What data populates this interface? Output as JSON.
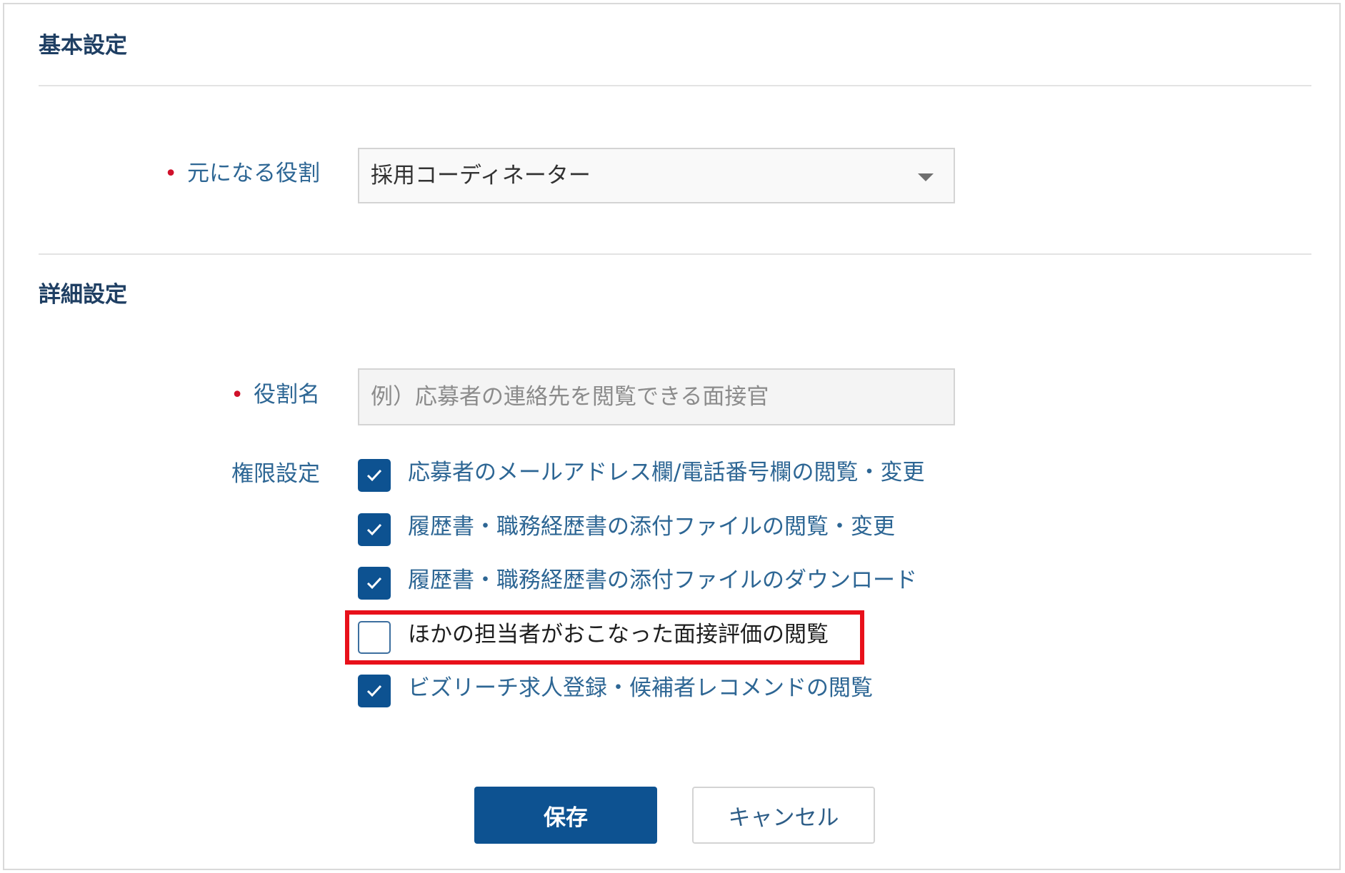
{
  "basic_settings": {
    "title": "基本設定",
    "base_role_label": "元になる役割",
    "base_role_value": "採用コーディネーター"
  },
  "detail_settings": {
    "title": "詳細設定",
    "role_name_label": "役割名",
    "role_name_placeholder": "例）応募者の連絡先を閲覧できる面接官",
    "role_name_value": "",
    "permissions_label": "権限設定",
    "permissions": [
      {
        "label": "応募者のメールアドレス欄/電話番号欄の閲覧・変更",
        "checked": true
      },
      {
        "label": "履歴書・職務経歴書の添付ファイルの閲覧・変更",
        "checked": true
      },
      {
        "label": "履歴書・職務経歴書の添付ファイルのダウンロード",
        "checked": true
      },
      {
        "label": "ほかの担当者がおこなった面接評価の閲覧",
        "checked": false
      },
      {
        "label": "ビズリーチ求人登録・候補者レコメンドの閲覧",
        "checked": true
      }
    ]
  },
  "actions": {
    "save_label": "保存",
    "cancel_label": "キャンセル"
  },
  "colors": {
    "accent": "#0d5291",
    "label_text": "#2d6694",
    "required_mark": "#d0112b",
    "highlight_border": "#e8101a"
  }
}
